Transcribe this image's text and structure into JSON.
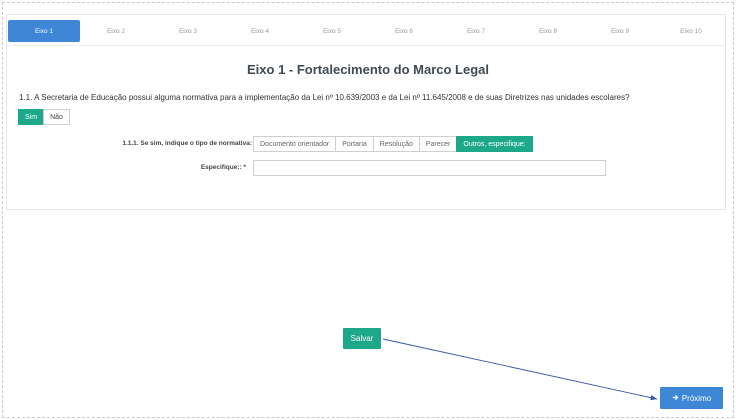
{
  "tabs": [
    {
      "label": "Eixo 1"
    },
    {
      "label": "Eixo 2"
    },
    {
      "label": "Eixo 3"
    },
    {
      "label": "Eixo 4"
    },
    {
      "label": "Eixo 5"
    },
    {
      "label": "Eixo 6"
    },
    {
      "label": "Eixo 7"
    },
    {
      "label": "Eixo 8"
    },
    {
      "label": "Eixo 9"
    },
    {
      "label": "Eixo 10"
    }
  ],
  "active_tab": "Eixo 1",
  "page_title": "Eixo 1 - Fortalecimento do Marco Legal",
  "question": {
    "text": "1.1. A Secretaria de Educação possui alguma normativa para a implementação da Lei nº 10.639/2003 e da Lei nº 11.645/2008 e de suas Diretrizes nas unidades escolares?",
    "yes_label": "Sim",
    "no_label": "Não",
    "selected": "Sim"
  },
  "sub_question": {
    "label": "1.1.1. Se sim, indique o tipo de normativa:",
    "options": [
      "Documento orientador",
      "Portaria",
      "Resolução",
      "Parecer",
      "Outros, especifique:"
    ],
    "selected": "Outros, especifique:"
  },
  "specify": {
    "label": "Especifique:: *",
    "value": ""
  },
  "buttons": {
    "save_label": "Salvar",
    "next_label": "Próximo"
  },
  "colors": {
    "primary_blue": "#3d87d6",
    "success_green": "#1ea88a",
    "annotation_arrow": "#3355aa"
  }
}
